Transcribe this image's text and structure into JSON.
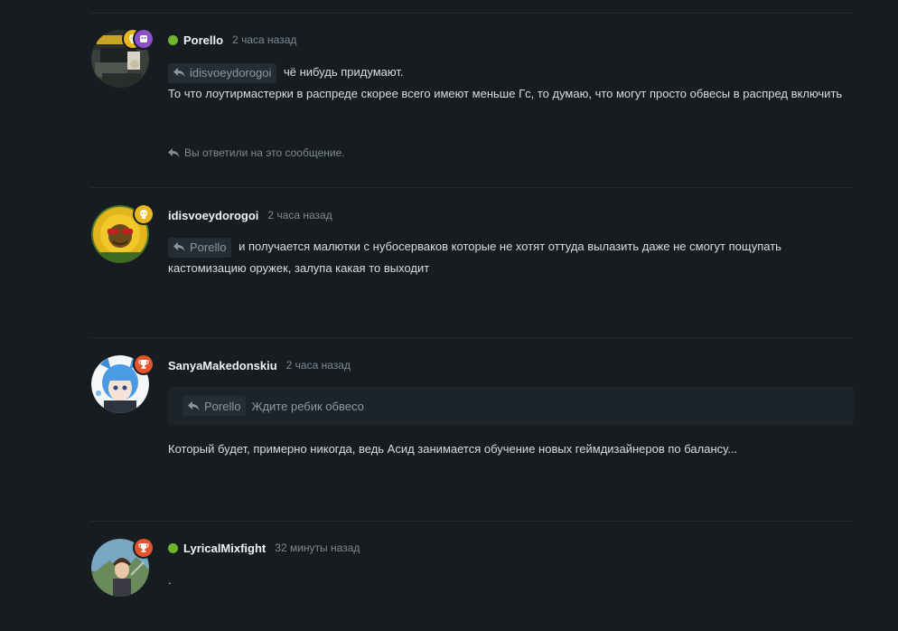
{
  "posts": [
    {
      "username": "Porello",
      "online": true,
      "time": "2 часа назад",
      "mention": "idisvoeydorogoi",
      "first_line": "чё нибудь придумают.",
      "text": "То что лоутирмастерки в распреде скорее всего имеют меньше Гс, то думаю, что могут просто обвесы в распред включить",
      "replied_note": "Вы ответили на это сообщение."
    },
    {
      "username": "idisvoeydorogoi",
      "online": false,
      "time": "2 часа назад",
      "mention": "Porello",
      "text": "и получается малютки с нубосерваков которые не хотят оттуда вылазить даже не смогут пощупать кастомизацию оружек, залупа какая то выходит"
    },
    {
      "username": "SanyaMakedonskiu",
      "online": false,
      "time": "2 часа назад",
      "quote_mention": "Porello",
      "quote_text": "Ждите ребик обвесо",
      "text": "Который будет, примерно никогда, ведь Асид занимается обучение новых геймдизайнеров по балансу..."
    },
    {
      "username": "LyricalMixfight",
      "online": true,
      "time": "32 минуты назад",
      "text": "."
    }
  ],
  "colors": {
    "background": "#161c20",
    "online": "#6fb52c",
    "badge_purple": "#8b4fc9",
    "badge_yellow": "#e8b820",
    "badge_orange": "#e2542a"
  },
  "icons": {
    "reply": "reply-arrow-icon",
    "trophy": "trophy-icon",
    "skull": "skull-icon",
    "heart": "heart-icon"
  }
}
